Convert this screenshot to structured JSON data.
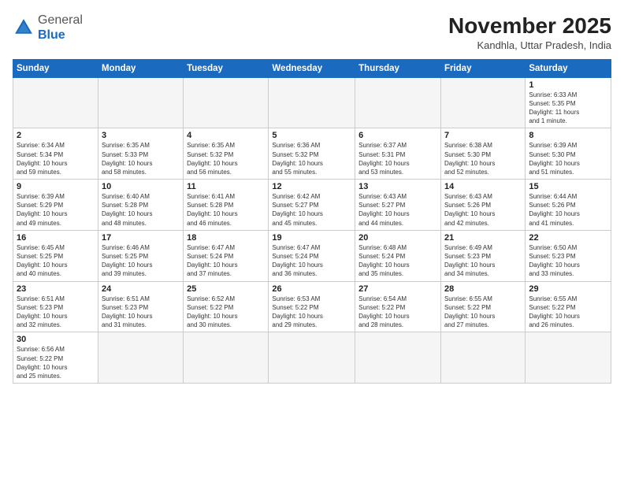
{
  "logo": {
    "general": "General",
    "blue": "Blue"
  },
  "header": {
    "month": "November 2025",
    "location": "Kandhla, Uttar Pradesh, India"
  },
  "weekdays": [
    "Sunday",
    "Monday",
    "Tuesday",
    "Wednesday",
    "Thursday",
    "Friday",
    "Saturday"
  ],
  "weeks": [
    [
      {
        "day": "",
        "info": ""
      },
      {
        "day": "",
        "info": ""
      },
      {
        "day": "",
        "info": ""
      },
      {
        "day": "",
        "info": ""
      },
      {
        "day": "",
        "info": ""
      },
      {
        "day": "",
        "info": ""
      },
      {
        "day": "1",
        "info": "Sunrise: 6:33 AM\nSunset: 5:35 PM\nDaylight: 11 hours\nand 1 minute."
      }
    ],
    [
      {
        "day": "2",
        "info": "Sunrise: 6:34 AM\nSunset: 5:34 PM\nDaylight: 10 hours\nand 59 minutes."
      },
      {
        "day": "3",
        "info": "Sunrise: 6:35 AM\nSunset: 5:33 PM\nDaylight: 10 hours\nand 58 minutes."
      },
      {
        "day": "4",
        "info": "Sunrise: 6:35 AM\nSunset: 5:32 PM\nDaylight: 10 hours\nand 56 minutes."
      },
      {
        "day": "5",
        "info": "Sunrise: 6:36 AM\nSunset: 5:32 PM\nDaylight: 10 hours\nand 55 minutes."
      },
      {
        "day": "6",
        "info": "Sunrise: 6:37 AM\nSunset: 5:31 PM\nDaylight: 10 hours\nand 53 minutes."
      },
      {
        "day": "7",
        "info": "Sunrise: 6:38 AM\nSunset: 5:30 PM\nDaylight: 10 hours\nand 52 minutes."
      },
      {
        "day": "8",
        "info": "Sunrise: 6:39 AM\nSunset: 5:30 PM\nDaylight: 10 hours\nand 51 minutes."
      }
    ],
    [
      {
        "day": "9",
        "info": "Sunrise: 6:39 AM\nSunset: 5:29 PM\nDaylight: 10 hours\nand 49 minutes."
      },
      {
        "day": "10",
        "info": "Sunrise: 6:40 AM\nSunset: 5:28 PM\nDaylight: 10 hours\nand 48 minutes."
      },
      {
        "day": "11",
        "info": "Sunrise: 6:41 AM\nSunset: 5:28 PM\nDaylight: 10 hours\nand 46 minutes."
      },
      {
        "day": "12",
        "info": "Sunrise: 6:42 AM\nSunset: 5:27 PM\nDaylight: 10 hours\nand 45 minutes."
      },
      {
        "day": "13",
        "info": "Sunrise: 6:43 AM\nSunset: 5:27 PM\nDaylight: 10 hours\nand 44 minutes."
      },
      {
        "day": "14",
        "info": "Sunrise: 6:43 AM\nSunset: 5:26 PM\nDaylight: 10 hours\nand 42 minutes."
      },
      {
        "day": "15",
        "info": "Sunrise: 6:44 AM\nSunset: 5:26 PM\nDaylight: 10 hours\nand 41 minutes."
      }
    ],
    [
      {
        "day": "16",
        "info": "Sunrise: 6:45 AM\nSunset: 5:25 PM\nDaylight: 10 hours\nand 40 minutes."
      },
      {
        "day": "17",
        "info": "Sunrise: 6:46 AM\nSunset: 5:25 PM\nDaylight: 10 hours\nand 39 minutes."
      },
      {
        "day": "18",
        "info": "Sunrise: 6:47 AM\nSunset: 5:24 PM\nDaylight: 10 hours\nand 37 minutes."
      },
      {
        "day": "19",
        "info": "Sunrise: 6:47 AM\nSunset: 5:24 PM\nDaylight: 10 hours\nand 36 minutes."
      },
      {
        "day": "20",
        "info": "Sunrise: 6:48 AM\nSunset: 5:24 PM\nDaylight: 10 hours\nand 35 minutes."
      },
      {
        "day": "21",
        "info": "Sunrise: 6:49 AM\nSunset: 5:23 PM\nDaylight: 10 hours\nand 34 minutes."
      },
      {
        "day": "22",
        "info": "Sunrise: 6:50 AM\nSunset: 5:23 PM\nDaylight: 10 hours\nand 33 minutes."
      }
    ],
    [
      {
        "day": "23",
        "info": "Sunrise: 6:51 AM\nSunset: 5:23 PM\nDaylight: 10 hours\nand 32 minutes."
      },
      {
        "day": "24",
        "info": "Sunrise: 6:51 AM\nSunset: 5:23 PM\nDaylight: 10 hours\nand 31 minutes."
      },
      {
        "day": "25",
        "info": "Sunrise: 6:52 AM\nSunset: 5:22 PM\nDaylight: 10 hours\nand 30 minutes."
      },
      {
        "day": "26",
        "info": "Sunrise: 6:53 AM\nSunset: 5:22 PM\nDaylight: 10 hours\nand 29 minutes."
      },
      {
        "day": "27",
        "info": "Sunrise: 6:54 AM\nSunset: 5:22 PM\nDaylight: 10 hours\nand 28 minutes."
      },
      {
        "day": "28",
        "info": "Sunrise: 6:55 AM\nSunset: 5:22 PM\nDaylight: 10 hours\nand 27 minutes."
      },
      {
        "day": "29",
        "info": "Sunrise: 6:55 AM\nSunset: 5:22 PM\nDaylight: 10 hours\nand 26 minutes."
      }
    ],
    [
      {
        "day": "30",
        "info": "Sunrise: 6:56 AM\nSunset: 5:22 PM\nDaylight: 10 hours\nand 25 minutes."
      },
      {
        "day": "",
        "info": ""
      },
      {
        "day": "",
        "info": ""
      },
      {
        "day": "",
        "info": ""
      },
      {
        "day": "",
        "info": ""
      },
      {
        "day": "",
        "info": ""
      },
      {
        "day": "",
        "info": ""
      }
    ]
  ]
}
